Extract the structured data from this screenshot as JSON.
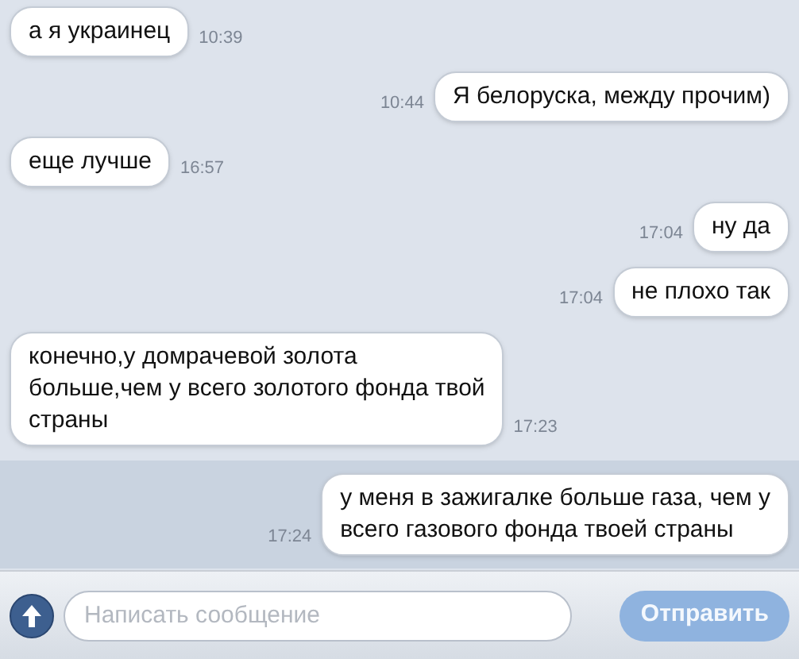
{
  "messages": [
    {
      "kind": "in",
      "text": "а я украинец",
      "time": "10:39",
      "selected": false
    },
    {
      "kind": "out",
      "text": "Я белоруска, между прочим)",
      "time": "10:44",
      "selected": false
    },
    {
      "kind": "in",
      "text": "еще лучше",
      "time": "16:57",
      "selected": false
    },
    {
      "kind": "out",
      "text": "ну да",
      "time": "17:04",
      "selected": false
    },
    {
      "kind": "out",
      "text": "не плохо так",
      "time": "17:04",
      "selected": false
    },
    {
      "kind": "in",
      "text": "конечно,у домрачевой золота\nбольше,чем у всего золотого фонда твой\nстраны",
      "time": "17:23",
      "selected": false
    },
    {
      "kind": "out",
      "text": "у меня в зажигалке больше газа, чем у\nвсего газового фонда твоей страны",
      "time": "17:24",
      "selected": true
    }
  ],
  "composer": {
    "placeholder": "Написать сообщение",
    "send": "Отправить",
    "send_disabled": true
  }
}
